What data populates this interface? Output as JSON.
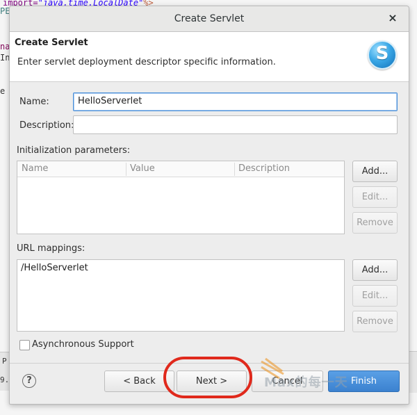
{
  "background": {
    "code_line1_attr": "import=",
    "code_line1_value": "\"java.time.LocalDate\"",
    "code_line1_end": "%>",
    "code_line2": "PE",
    "code_line3": "na",
    "code_line4": "In",
    "code_line5": "e",
    "panel_left1": "P",
    "panel_left2": "9."
  },
  "dialog": {
    "window_title": "Create Servlet",
    "close_glyph": "×",
    "header_title": "Create Servlet",
    "header_description": "Enter servlet deployment descriptor specific information.",
    "servlet_icon_letter": "S"
  },
  "form": {
    "name_label": "Name:",
    "name_value": "HelloServerlet",
    "description_label": "Description:",
    "description_value": "",
    "init_params_label": "Initialization parameters:",
    "init_params_columns": [
      "Name",
      "Value",
      "Description"
    ],
    "init_buttons": {
      "add": "Add...",
      "edit": "Edit...",
      "remove": "Remove"
    },
    "url_mappings_label": "URL mappings:",
    "url_mappings": [
      "/HelloServerlet"
    ],
    "url_buttons": {
      "add": "Add...",
      "edit": "Edit...",
      "remove": "Remove"
    },
    "async_label": "Asynchronous Support",
    "async_checked": false
  },
  "footer": {
    "help_glyph": "?",
    "back_label": "< Back",
    "next_label": "Next >",
    "cancel_label": "Cancel",
    "finish_label": "Finish"
  },
  "watermark": {
    "text": "Max的每一天"
  },
  "colors": {
    "accent": "#4a90d9",
    "annotation": "#e0291c",
    "primary_button": "#3b81cf"
  }
}
